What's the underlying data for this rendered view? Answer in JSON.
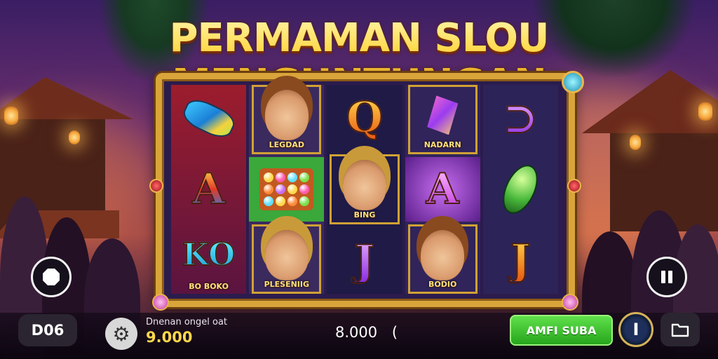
{
  "title": "PERMAMAN SLOU MENGUNTUNGAN",
  "reels": [
    [
      {
        "kind": "gem-blue",
        "caption": ""
      },
      {
        "kind": "letter",
        "text": "A",
        "caption": ""
      },
      {
        "kind": "letter",
        "text": "KO",
        "caption": "BO BOKO"
      }
    ],
    [
      {
        "kind": "face",
        "caption": "LEGDAD"
      },
      {
        "kind": "balls",
        "caption": ""
      },
      {
        "kind": "face-blonde",
        "caption": "PLESENIIG"
      }
    ],
    [
      {
        "kind": "letter",
        "text": "Q",
        "caption": ""
      },
      {
        "kind": "face-blonde",
        "caption": "BING"
      },
      {
        "kind": "letter",
        "text": "J",
        "caption": ""
      }
    ],
    [
      {
        "kind": "crystal",
        "caption": "NADARN"
      },
      {
        "kind": "letter",
        "text": "A",
        "caption": ""
      },
      {
        "kind": "face",
        "caption": "BODIO"
      }
    ],
    [
      {
        "kind": "letter",
        "text": "⊃",
        "caption": ""
      },
      {
        "kind": "gem-green",
        "caption": ""
      },
      {
        "kind": "letter",
        "text": "J",
        "caption": ""
      }
    ]
  ],
  "bottom": {
    "level_label": "D06",
    "settings_icon": "gear-icon",
    "balance_label": "Dnenan ongel oat",
    "balance_value": "9.000",
    "bet_value": "8.000",
    "bet_suffix": "(",
    "spin_label": "AMFI SUBA",
    "badge_label": "I",
    "folder_icon": "folder-icon"
  },
  "controls": {
    "left_button_icon": "octagon-icon",
    "right_button_icon": "pause-icon"
  },
  "colors": {
    "title_gold": "#ffd43a",
    "frame_gold": "#d9a53a",
    "spin_green": "#26a51c",
    "balance_yellow": "#ffd84a"
  }
}
